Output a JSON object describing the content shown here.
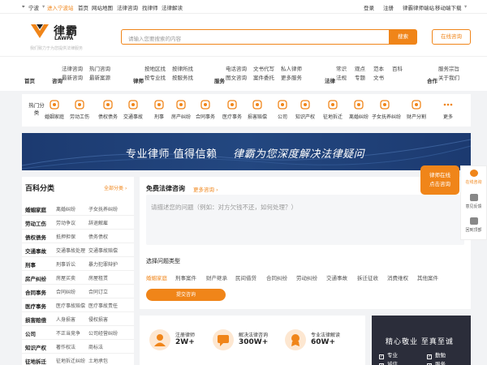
{
  "topbar": {
    "city": "宁波",
    "enter_city": "进入宁波站",
    "links": [
      "首页",
      "网站地图",
      "法律咨询",
      "找律师",
      "法律解读"
    ],
    "login": "登录",
    "register": "注册",
    "lawyer_site": "律霸律师端站",
    "mobile_download": "移动端下载"
  },
  "header": {
    "logo_cn": "律霸",
    "logo_en": "LAWPA",
    "slogan": "我们致力于为您提供法律服务",
    "search_placeholder": "请输入您要搜索的内容",
    "search_button": "搜索",
    "consult_button": "在线咨询"
  },
  "nav": [
    {
      "title": "首页",
      "items": []
    },
    {
      "title": "咨询",
      "items": [
        "法律咨询",
        "热门咨询",
        "最新咨询",
        "最新案源"
      ]
    },
    {
      "title": "律师",
      "items": [
        "按地区找",
        "按律所找",
        "按专业找",
        "按服务找"
      ]
    },
    {
      "title": "服务",
      "items": [
        "电话咨询",
        "文书代写",
        "私人律师",
        "图文咨询",
        "案件委托",
        "更多服务"
      ]
    },
    {
      "title": "法律",
      "items": [
        "常识",
        "观点",
        "范本",
        "百科",
        "法规",
        "专题",
        "文书"
      ]
    },
    {
      "title": "合作",
      "items": [
        "服务宗旨",
        "关于我们"
      ]
    }
  ],
  "categories": {
    "label": "热门分类",
    "items": [
      "婚姻家庭",
      "劳动工伤",
      "债权债务",
      "交通事故",
      "刑事",
      "房产纠纷",
      "合同事务",
      "医疗事务",
      "损害赔偿",
      "公司",
      "知识产权",
      "征地拆迁",
      "离婚纠纷",
      "子女抚养纠纷",
      "财产分割",
      "更多"
    ]
  },
  "banner": {
    "text1": "专业律师 值得信赖",
    "text2": "律霸为您深度解决法律疑问"
  },
  "sidebar": {
    "title": "百科分类",
    "all_label": "全部分类",
    "rows": [
      {
        "head": "婚姻家庭",
        "a": "离婚纠纷",
        "b": "子女抚养纠纷"
      },
      {
        "head": "劳动工伤",
        "a": "劳动争议",
        "b": "辞退解雇"
      },
      {
        "head": "债权债务",
        "a": "抵押担保",
        "b": "债务债权"
      },
      {
        "head": "交通事故",
        "a": "交通事故处理",
        "b": "交通事故赔偿"
      },
      {
        "head": "刑事",
        "a": "刑事诉讼",
        "b": "暴力犯罪辩护"
      },
      {
        "head": "房产纠纷",
        "a": "房屋买卖",
        "b": "房屋租赁"
      },
      {
        "head": "合同事务",
        "a": "合同纠纷",
        "b": "合同订立"
      },
      {
        "head": "医疗事务",
        "a": "医疗事故赔偿",
        "b": "医疗事故责任"
      },
      {
        "head": "损害赔偿",
        "a": "人身损害",
        "b": "侵权损害"
      },
      {
        "head": "公司",
        "a": "不正当竞争",
        "b": "公司经营纠纷"
      },
      {
        "head": "知识产权",
        "a": "著作权法",
        "b": "商标法"
      },
      {
        "head": "征地拆迁",
        "a": "征地拆迁纠纷",
        "b": "土地承包"
      }
    ]
  },
  "consult": {
    "title": "免费法律咨询",
    "more": "更多咨询",
    "placeholder": "请描述您的问题（例如：对方欠钱不还，如何处理？）",
    "type_title": "选择问题类型",
    "types": [
      "婚姻家庭",
      "刑事案件",
      "财产继承",
      "民间借贷",
      "合同纠纷",
      "劳动纠纷",
      "交通事故",
      "拆迁征收",
      "消费维权",
      "其他案件"
    ],
    "submit": "提交咨询"
  },
  "stats": [
    {
      "label": "注册律师",
      "value": "2W+"
    },
    {
      "label": "解决法律咨询",
      "value": "300W+"
    },
    {
      "label": "专业法律解读",
      "value": "60W+"
    }
  ],
  "recruit": {
    "title": "精心敬业 至真至诚",
    "checks": [
      "专业",
      "勤勉",
      "诚信",
      "服务"
    ]
  },
  "float": {
    "bubble": [
      "律师在线",
      "点击咨询"
    ],
    "items": [
      "在线咨询",
      "意见反馈",
      "回到顶部"
    ]
  },
  "colors": {
    "accent": "#f08519",
    "banner": "#1c3a70"
  }
}
